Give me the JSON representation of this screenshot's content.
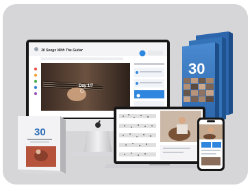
{
  "product": {
    "course_title": "30 Songs With The Guitar",
    "day_label": "Day 1/7",
    "cover_number": "30",
    "apple_logo": "apple-logo-icon"
  },
  "colors": {
    "panel_bg": "#d6d6d8",
    "box_blue": "#3a78c0",
    "box_dark": "#1d4d88",
    "accent_blue": "#2f86de",
    "device_black": "#161616"
  }
}
